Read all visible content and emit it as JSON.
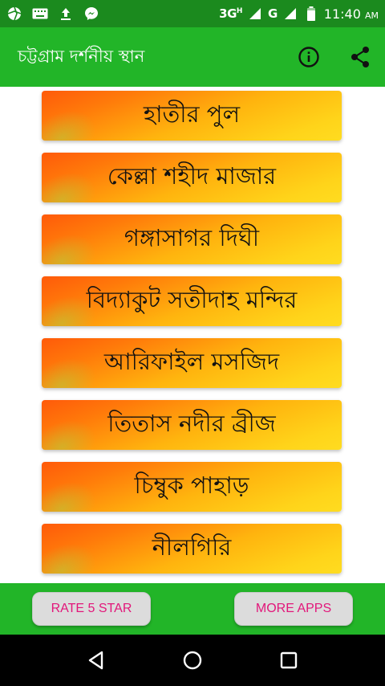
{
  "status_bar": {
    "network": "3G",
    "network_superscript": "H",
    "network2": "G",
    "time": "11:40",
    "ampm": "AM",
    "icons": [
      "shutter-icon",
      "keyboard-icon",
      "upload-icon",
      "messenger-icon",
      "signal-icon",
      "battery-icon"
    ]
  },
  "app_bar": {
    "title": "চট্টগ্রাম দর্শনীয় স্থান",
    "actions": [
      "info-icon",
      "share-icon"
    ]
  },
  "list": {
    "items": [
      {
        "label": "হাতীর পুল"
      },
      {
        "label": "কেল্লা শহীদ মাজার"
      },
      {
        "label": "গঙ্গাসাগর দিঘী"
      },
      {
        "label": "বিদ্যাকুট সতীদাহ মন্দির"
      },
      {
        "label": "আরিফাইল মসজিদ"
      },
      {
        "label": "তিতাস নদীর ব্রীজ"
      },
      {
        "label": "চিম্বুক পাহাড়"
      },
      {
        "label": "নীলগিরি"
      }
    ]
  },
  "bottom_bar": {
    "rate_label": "RATE 5 STAR",
    "more_label": "MORE APPS"
  },
  "nav_bar": {
    "icons": [
      "back-icon",
      "home-icon",
      "recents-icon"
    ]
  },
  "colors": {
    "status_bar": "#1b8a1e",
    "app_bar": "#22b528",
    "button_text": "#e2167a",
    "item_gradient_start": "#ff5a0a",
    "item_gradient_end": "#ffdc20"
  }
}
